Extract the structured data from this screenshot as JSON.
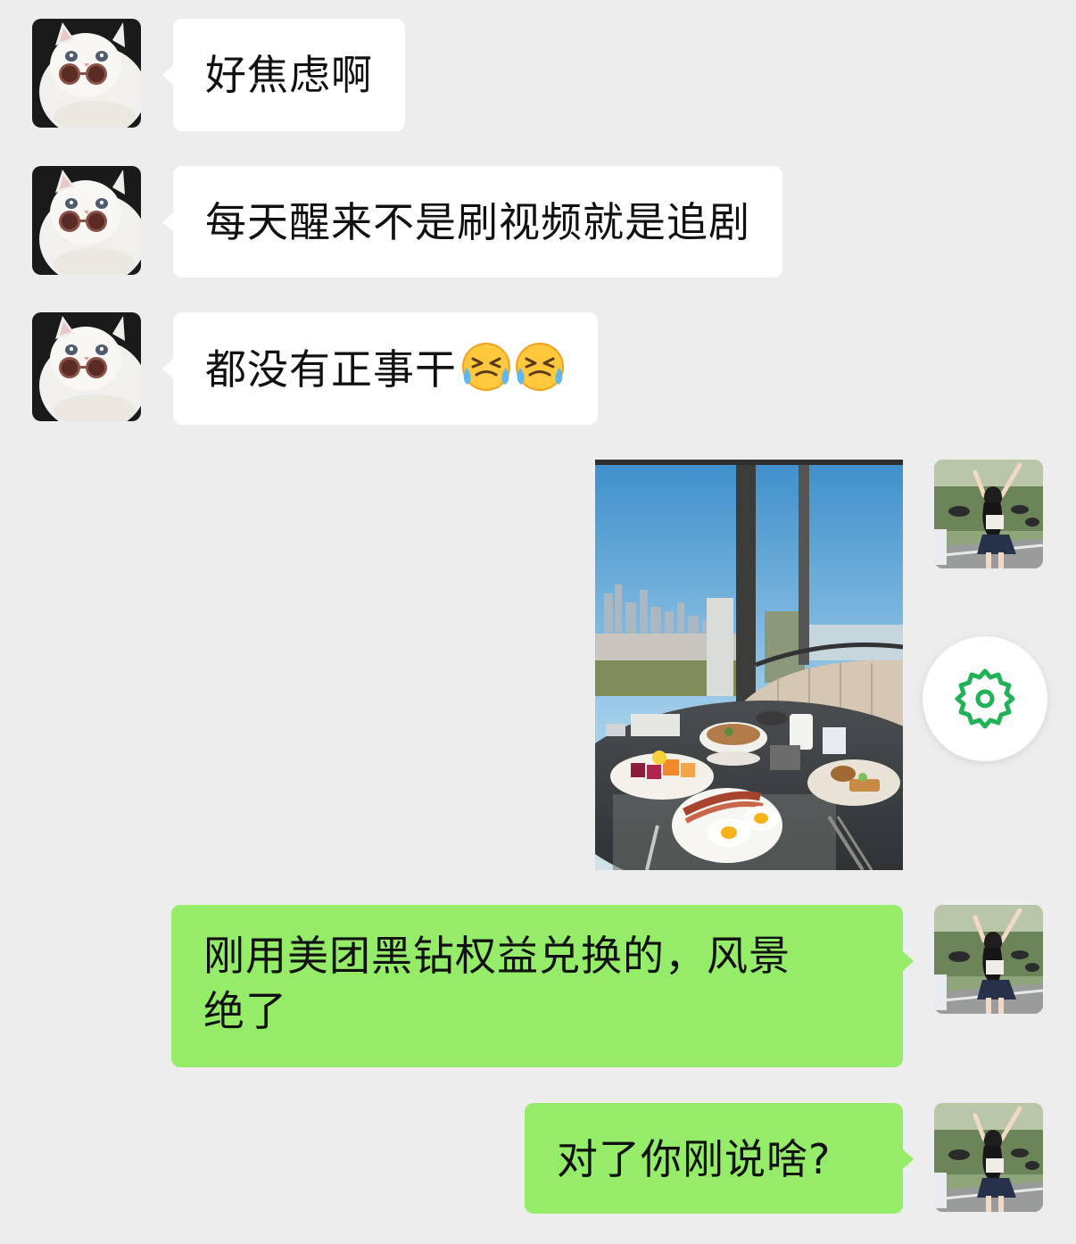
{
  "chat": {
    "messages": [
      {
        "side": "in",
        "text": "好焦虑啊"
      },
      {
        "side": "in",
        "text": "每天醒来不是刷视频就是追剧"
      },
      {
        "side": "in",
        "text": "都没有正事干",
        "emoji": [
          "crying-laughing-face",
          "crying-laughing-face"
        ]
      },
      {
        "side": "out",
        "type": "image",
        "image": "breakfast-by-window-photo"
      },
      {
        "side": "out",
        "text_line1": "刚用美团黑钻权益兑换的，风景",
        "text_line2": "绝了"
      },
      {
        "side": "out",
        "text": "对了你刚说啥?"
      }
    ]
  },
  "floating": {
    "icon": "gear-icon",
    "accent": "#21b258"
  },
  "colors": {
    "background": "#ededed",
    "incoming_bubble": "#ffffff",
    "outgoing_bubble": "#95ec69",
    "text": "#111111"
  }
}
